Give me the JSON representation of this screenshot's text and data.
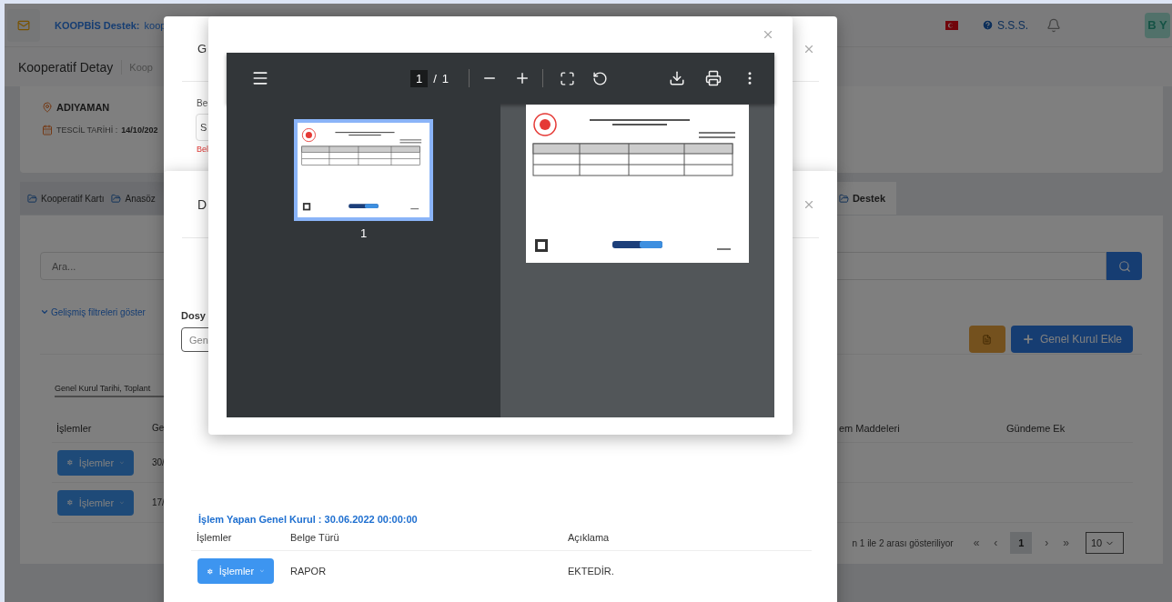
{
  "topbar": {
    "support_label": "KOOPBİS Destek:",
    "support_value": "koop",
    "faq": "S.S.S.",
    "avatar": "B Y"
  },
  "header": {
    "title": "Kooperatif Detay",
    "breadcrumb": "Koop"
  },
  "info": {
    "city": "ADIYAMAN",
    "registration_label": "TESCİL TARİHİ :",
    "registration_date": "14/10/202"
  },
  "tabs": [
    {
      "label": "Kooperatif Kartı",
      "selected": false
    },
    {
      "label": "Anasöz",
      "selected": false
    },
    {
      "label": "Destek",
      "selected": true
    }
  ],
  "search": {
    "placeholder": "Ara..."
  },
  "filters_toggle": "Gelişmiş filtreleri göster",
  "add_button": "Genel Kurul Ekle",
  "sort": {
    "value": "Genel Kurul Tarihi, Toplant"
  },
  "table": {
    "columns": [
      "İşlemler",
      "Ge",
      "em Maddeleri",
      "Gündeme Ek"
    ],
    "rows": [
      {
        "action": "İşlemler",
        "column_2": "30/"
      },
      {
        "action": "İşlemler",
        "column_2": "17/"
      }
    ]
  },
  "pagination": {
    "summary": "n 1 ile 2 arası gösteriliyor",
    "first": "«",
    "prev": "‹",
    "pages": [
      {
        "label": "1",
        "selected": true
      }
    ],
    "next": "›",
    "last": "»",
    "page_size": "10"
  },
  "back_modal": {
    "title": "G",
    "field_label": "Be",
    "field_value": "S",
    "error": "Bel"
  },
  "document_modal": {
    "title": "D",
    "file_label": "Dosy",
    "file_value": "Gen",
    "section_title": "İşlem Yapan Genel Kurul : 30.06.2022 00:00:00",
    "columns": [
      "İşlemler",
      "Belge Türü",
      "Açıklama"
    ],
    "rows": [
      {
        "action": "İşlemler",
        "type": "RAPOR",
        "description": "EKTEDİR."
      }
    ]
  },
  "pdf_viewer": {
    "page_current": "1",
    "page_separator": "/",
    "page_total": "1",
    "thumbnails": [
      {
        "label": "1",
        "selected": true
      }
    ]
  }
}
